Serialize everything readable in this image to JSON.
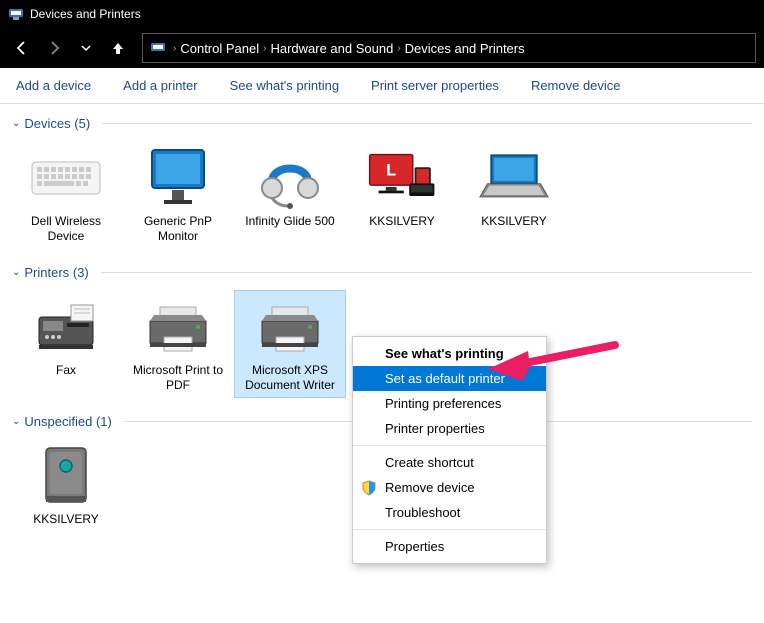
{
  "window": {
    "title": "Devices and Printers"
  },
  "breadcrumb": {
    "root": "Control Panel",
    "mid": "Hardware and Sound",
    "leaf": "Devices and Printers"
  },
  "toolbar": {
    "add_device": "Add a device",
    "add_printer": "Add a printer",
    "see_printing": "See what's printing",
    "server_props": "Print server properties",
    "remove_device": "Remove device"
  },
  "sections": {
    "devices": {
      "label": "Devices",
      "count": "(5)"
    },
    "printers": {
      "label": "Printers",
      "count": "(3)"
    },
    "unspecified": {
      "label": "Unspecified",
      "count": "(1)"
    }
  },
  "devices": [
    {
      "label": "Dell Wireless Device"
    },
    {
      "label": "Generic PnP Monitor"
    },
    {
      "label": "Infinity Glide 500"
    },
    {
      "label": "KKSILVERY"
    },
    {
      "label": "KKSILVERY"
    }
  ],
  "printers": [
    {
      "label": "Fax"
    },
    {
      "label": "Microsoft Print to PDF"
    },
    {
      "label": "Microsoft XPS Document Writer"
    }
  ],
  "unspecified": [
    {
      "label": "KKSILVERY"
    }
  ],
  "context_menu": {
    "see_printing": "See what's printing",
    "set_default": "Set as default printer",
    "printing_prefs": "Printing preferences",
    "printer_props": "Printer properties",
    "create_shortcut": "Create shortcut",
    "remove_device": "Remove device",
    "troubleshoot": "Troubleshoot",
    "properties": "Properties"
  },
  "selected_printer_index": 2,
  "highlighted_menu_item": "set_default"
}
